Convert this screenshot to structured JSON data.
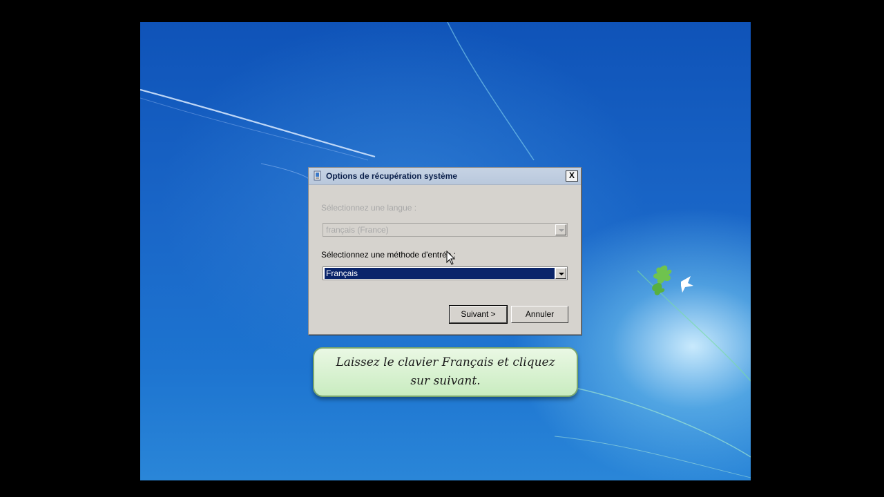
{
  "dialog": {
    "title": "Options de récupération système",
    "close_label": "X",
    "language_label": "Sélectionnez une langue :",
    "language_value": "français (France)",
    "input_method_label": "Sélectionnez une méthode d'entrée :",
    "input_method_value": "Français",
    "next_label": "Suivant >",
    "cancel_label": "Annuler"
  },
  "caption": {
    "text": "Laissez le clavier Français et cliquez sur suivant."
  },
  "colors": {
    "selection": "#0a246a",
    "dialog_bg": "#d6d3ce",
    "caption_bg": "#c9ecc0"
  },
  "icons": [
    "recovery-icon",
    "close-icon",
    "dropdown-arrow-icon",
    "mouse-pointer-icon",
    "windows-bird-logo"
  ]
}
